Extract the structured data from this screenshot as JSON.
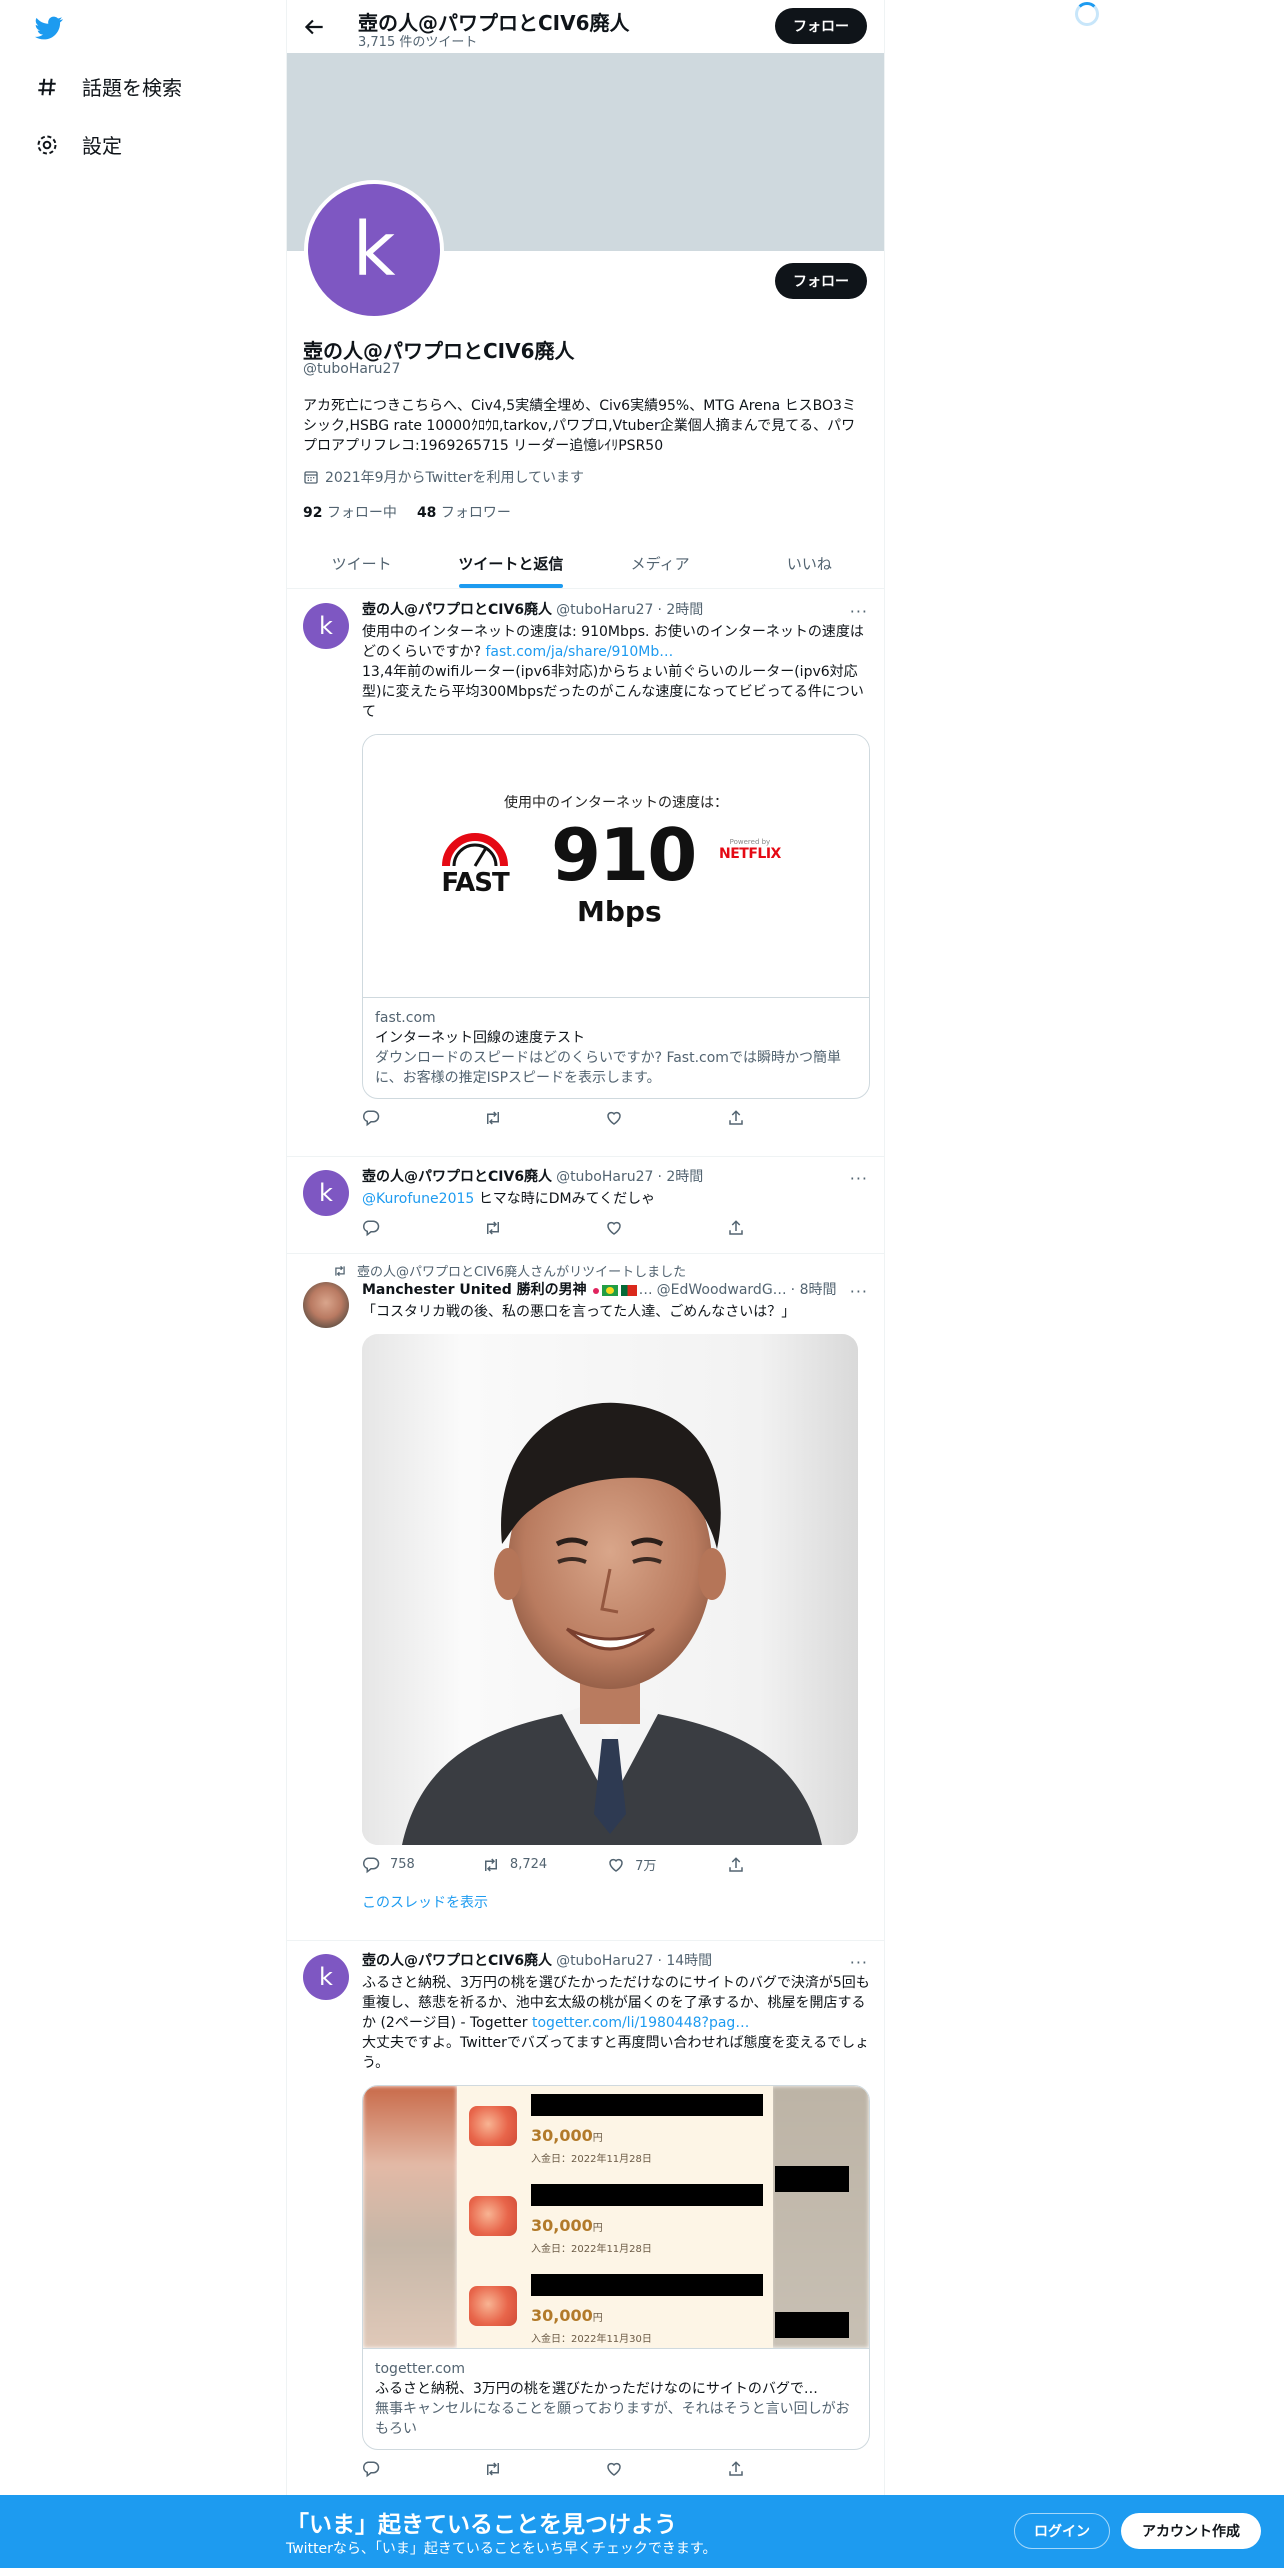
{
  "nav": {
    "explore": "話題を検索",
    "settings": "設定"
  },
  "header": {
    "title": "壺の人@パワプロとCIV6廃人",
    "subtitle": "3,715 件のツイート",
    "follow": "フォロー"
  },
  "profile": {
    "avatar_letter": "k",
    "follow": "フォロー",
    "name": "壺の人@パワプロとCIV6廃人",
    "handle": "@tuboHaru27",
    "bio": "アカ死亡につきこちらへ、Civ4,5実績全埋め、Civ6実績95%、MTG Arena ヒスBO3ミシック,HSBG rate 10000ｸﾛｳﾛ,tarkov,パワプロ,Vtuber企業個人摘まんで見てる、パワプロアプリフレコ:1969265715 リーダー追憶ﾚｲﾘPSR50",
    "joined": "2021年9月からTwitterを利用しています",
    "following_count": "92",
    "following_label": "フォロー中",
    "followers_count": "48",
    "followers_label": "フォロワー"
  },
  "tabs": [
    "ツイート",
    "ツイートと返信",
    "メディア",
    "いいね"
  ],
  "tweets": [
    {
      "name": "壺の人@パワプロとCIV6廃人",
      "handle": "@tuboHaru27",
      "time": "· 2時間",
      "text_before": "使用中のインターネットの速度は: 910Mbps. お使いのインターネットの速度はどのくらいですか? ",
      "link": "fast.com/ja/share/910Mb…",
      "text_after": "13,4年前のwifiルーター(ipv6非対応)からちょい前ぐらいのルーター(ipv6対応型)に変えたら平均300Mbpsだったのがこんな速度になってビビってる件について",
      "card": {
        "fast_title": "使用中のインターネットの速度は：",
        "fast_logo": "FAST",
        "speed": "910",
        "unit": "Mbps",
        "powered": "Powered by",
        "netflix": "NETFLIX",
        "domain": "fast.com",
        "title": "インターネット回線の速度テスト",
        "desc": "ダウンロードのスピードはどのくらいですか? Fast.comでは瞬時かつ簡単に、お客様の推定ISPスピードを表示します。"
      }
    },
    {
      "name": "壺の人@パワプロとCIV6廃人",
      "handle": "@tuboHaru27",
      "time": "· 2時間",
      "mention": "@Kurofune2015",
      "text": " ヒマな時にDMみてくだしゃ"
    },
    {
      "retweeted_by": "壺の人@パワプロとCIV6廃人さんがリツイートしました",
      "name": "Manchester United 勝利の男神",
      "handle": "@EdWoodwardG…",
      "time": "· 8時間",
      "text": "「コスタリカ戦の後、私の悪口を言ってた人達、ごめんなさいは？」",
      "replies": "758",
      "retweets": "8,724",
      "likes": "7万",
      "show_thread": "このスレッドを表示"
    },
    {
      "name": "壺の人@パワプロとCIV6廃人",
      "handle": "@tuboHaru27",
      "time": "· 14時間",
      "text_before": "ふるさと納税、3万円の桃を選びたかっただけなのにサイトのバグで決済が5回も重複し、慈悲を祈るか、池中玄太級の桃が届くのを了承するか、桃屋を開店するか (2ページ目) - Togetter ",
      "link": "togetter.com/li/1980448?pag…",
      "text_after": "大丈夫ですよ。Twitterでバズってますと再度問い合わせれば態度を変えるでしょう。",
      "card": {
        "rows": [
          {
            "amount": "30,000",
            "yen": "円",
            "date": "入金日：2022年11月28日"
          },
          {
            "amount": "30,000",
            "yen": "円",
            "date": "入金日：2022年11月28日"
          },
          {
            "amount": "30,000",
            "yen": "円",
            "date": "入金日：2022年11月30日"
          }
        ],
        "domain": "togetter.com",
        "title": "ふるさと納税、3万円の桃を選びたかっただけなのにサイトのバグで…",
        "desc": "無事キャンセルになることを願っておりますが、それはそうと言い回しがおもろい"
      }
    }
  ],
  "bottom": {
    "title": "「いま」起きていることを見つけよう",
    "sub": "Twitterなら、「いま」起きていることをいち早くチェックできます。",
    "login": "ログイン",
    "signup": "アカウント作成"
  },
  "colors": {
    "accent": "#1d9bf0",
    "avatar": "#7e57c2",
    "banner": "#cfd9de"
  }
}
